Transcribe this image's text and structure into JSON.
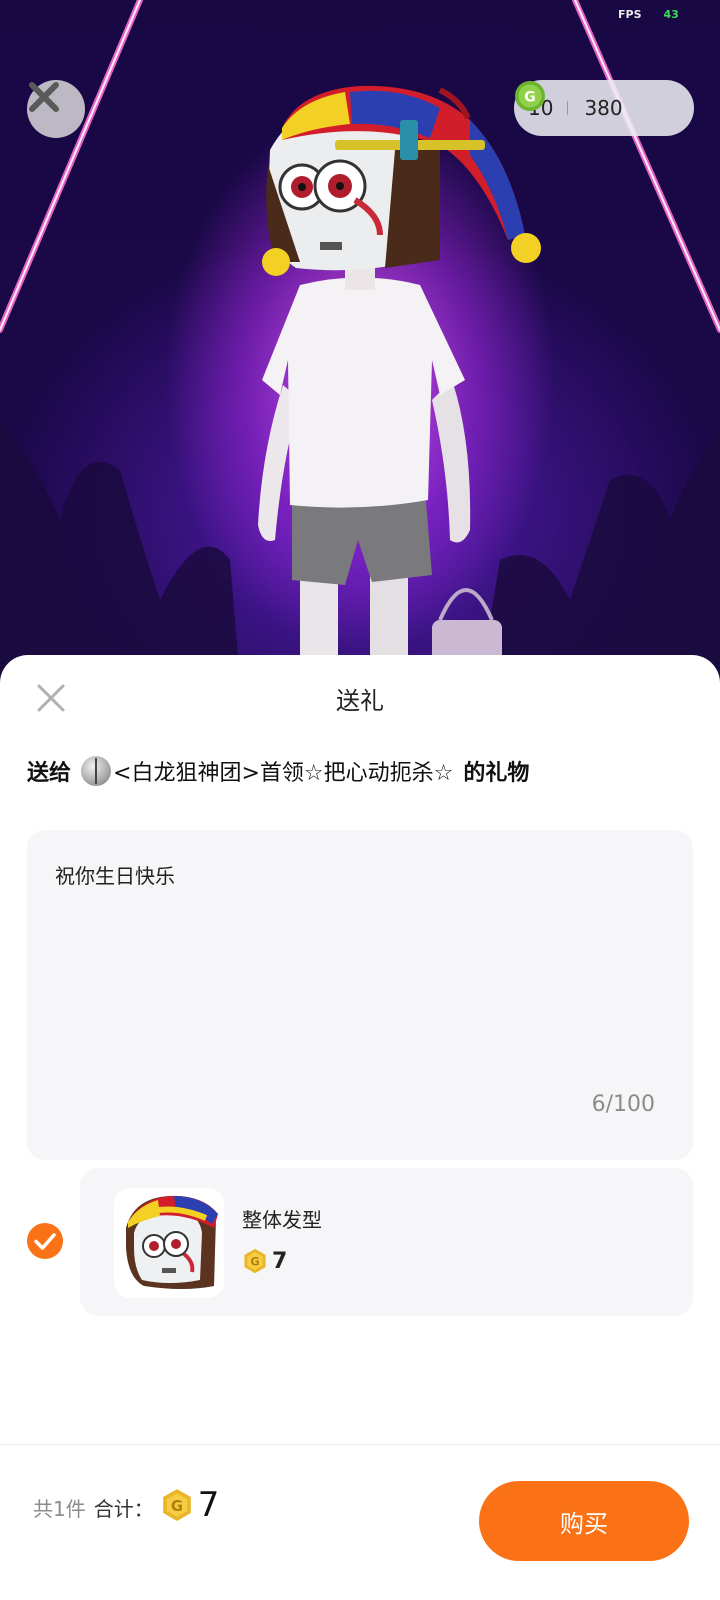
{
  "status": {
    "fps_label": "FPS",
    "fps_value": "43"
  },
  "wallet": {
    "gold_coins": "10",
    "green_coins": "380"
  },
  "sheet": {
    "title": "送礼",
    "recipient_prefix": "送给",
    "recipient_name": "<白龙狙神团>首领☆把心动扼杀☆",
    "recipient_suffix": "的礼物",
    "message": "祝你生日快乐",
    "char_count": "6/100"
  },
  "gift": {
    "name": "整体发型",
    "price": "7",
    "selected": true
  },
  "footer": {
    "item_count": "共1件",
    "total_label": "合计：",
    "total_value": "7",
    "buy_label": "购买"
  },
  "colors": {
    "accent": "#fb7115",
    "coin_gold": "#e9b628",
    "coin_green": "#7cc43a",
    "sheet_bg": "#ffffff",
    "card_bg": "#f6f5f8"
  },
  "icons": [
    "close-icon",
    "gold-coin-icon",
    "green-coin-icon",
    "check-icon"
  ]
}
